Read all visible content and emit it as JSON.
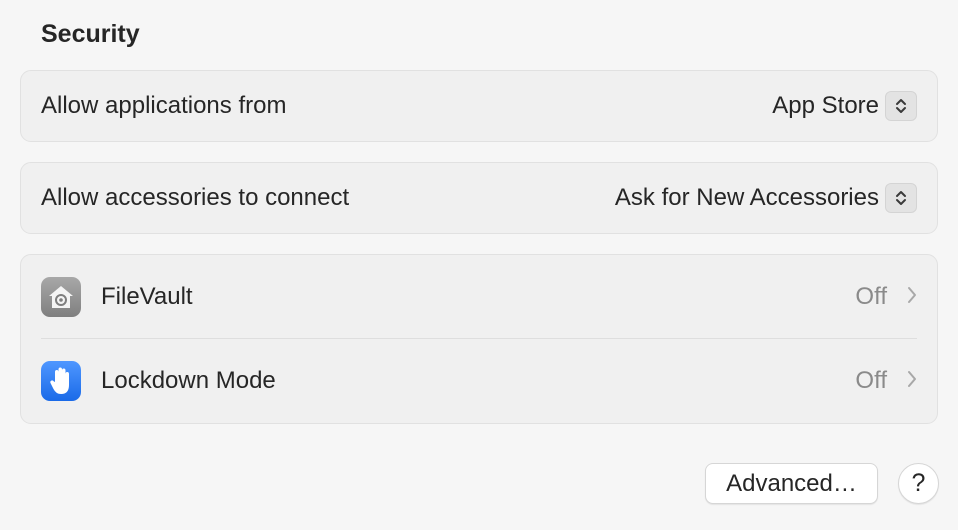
{
  "section": {
    "title": "Security"
  },
  "allow_apps": {
    "label": "Allow applications from",
    "value": "App Store"
  },
  "allow_accessories": {
    "label": "Allow accessories to connect",
    "value": "Ask for New Accessories"
  },
  "security_items": [
    {
      "label": "FileVault",
      "value": "Off",
      "icon": "filevault-icon"
    },
    {
      "label": "Lockdown Mode",
      "value": "Off",
      "icon": "lockdown-hand-icon"
    }
  ],
  "footer": {
    "advanced_label": "Advanced…",
    "help_label": "?"
  },
  "colors": {
    "background": "#f6f6f6",
    "group_background": "#f0f0f0",
    "filevault_icon": "#8e8e8e",
    "lockdown_icon": "#2f7cf6",
    "secondary_text": "#8a8a8a"
  }
}
